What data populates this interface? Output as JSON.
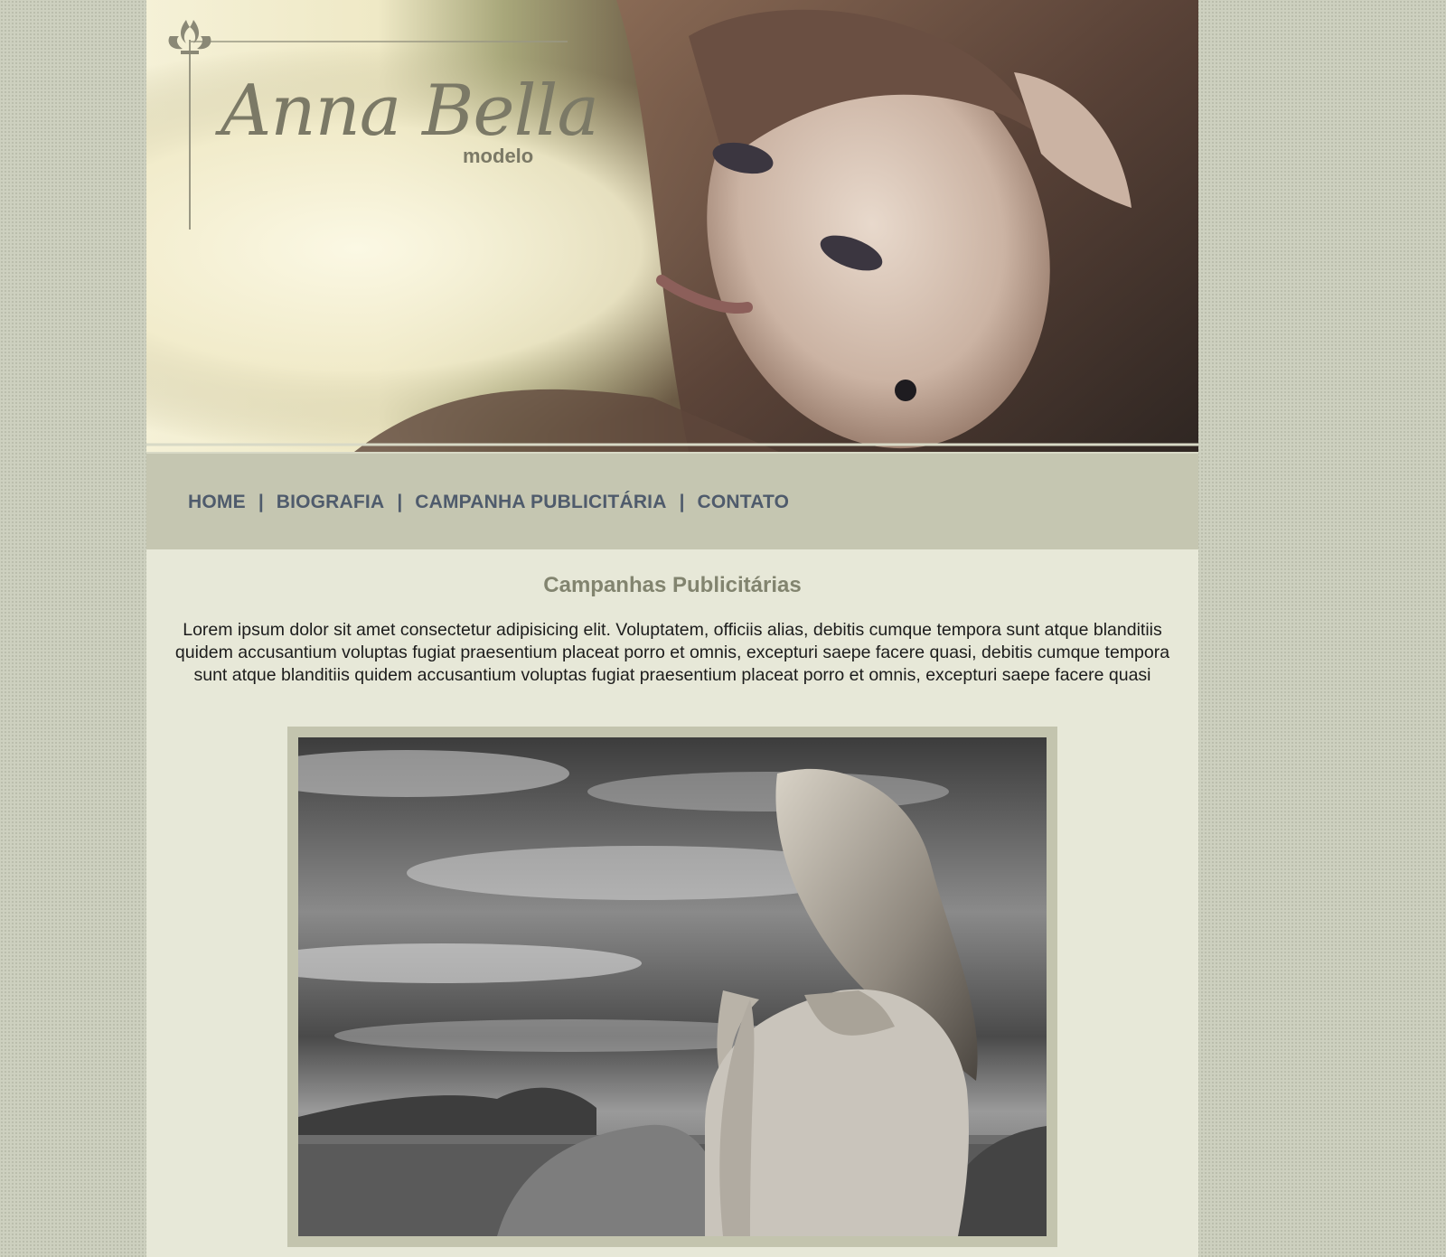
{
  "brand": {
    "name": "Anna Bella",
    "tagline": "modelo"
  },
  "nav": {
    "items": [
      {
        "label": "HOME"
      },
      {
        "label": "BIOGRAFIA"
      },
      {
        "label": "CAMPANHA PUBLICITÁRIA"
      },
      {
        "label": "CONTATO"
      }
    ],
    "separator": "|"
  },
  "main": {
    "title": "Campanhas Publicitárias",
    "paragraph": "Lorem ipsum dolor sit amet consectetur adipisicing elit. Voluptatem, officiis alias, debitis cumque tempora sunt atque blanditiis quidem accusantium voluptas fugiat praesentium placeat porro et omnis, excepturi saepe facere quasi, debitis cumque tempora sunt atque blanditiis quidem accusantium voluptas fugiat praesentium placeat porro et omnis, excepturi saepe facere quasi"
  },
  "colors": {
    "page_background": "#cdd0bf",
    "content_background": "#e7e8d8",
    "nav_background": "#c5c6b1",
    "nav_text": "#4f5b6c",
    "title_text": "#82846f"
  }
}
